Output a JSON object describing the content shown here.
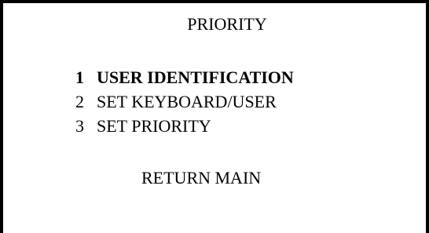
{
  "screen": {
    "title": "PRIORITY",
    "menu": [
      {
        "number": "1",
        "label": "USER IDENTIFICATION",
        "selected": true
      },
      {
        "number": "2",
        "label": "SET KEYBOARD/USER",
        "selected": false
      },
      {
        "number": "3",
        "label": "SET PRIORITY",
        "selected": false
      }
    ],
    "return_label": "RETURN MAIN"
  }
}
